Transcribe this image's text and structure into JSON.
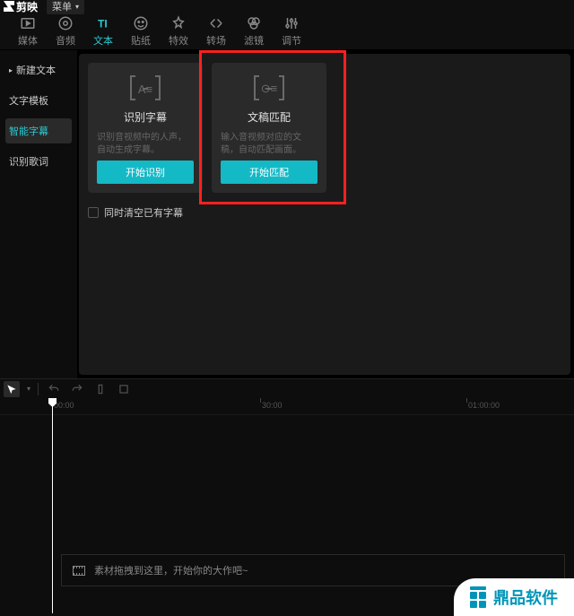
{
  "titlebar": {
    "app_name": "剪映",
    "menu_label": "菜单"
  },
  "toolbar": [
    {
      "id": "media",
      "label": "媒体"
    },
    {
      "id": "audio",
      "label": "音频"
    },
    {
      "id": "text",
      "label": "文本",
      "active": true
    },
    {
      "id": "sticker",
      "label": "贴纸"
    },
    {
      "id": "effect",
      "label": "特效"
    },
    {
      "id": "transition",
      "label": "转场"
    },
    {
      "id": "filter",
      "label": "滤镜"
    },
    {
      "id": "adjust",
      "label": "调节"
    }
  ],
  "sidebar": [
    {
      "id": "new-text",
      "label": "新建文本",
      "has_arrow": true
    },
    {
      "id": "text-template",
      "label": "文字模板"
    },
    {
      "id": "smart-subtitle",
      "label": "智能字幕",
      "active": true
    },
    {
      "id": "lyrics",
      "label": "识别歌词"
    }
  ],
  "cards": [
    {
      "id": "recognize",
      "icon_glyph": "A≡",
      "title": "识别字幕",
      "desc": "识别音视频中的人声，自动生成字幕。",
      "button": "开始识别"
    },
    {
      "id": "match",
      "icon_glyph": "⊙≡",
      "title": "文稿匹配",
      "desc": "输入音视频对应的文稿，自动匹配画面。",
      "button": "开始匹配",
      "highlighted": true
    }
  ],
  "checkbox": {
    "label": "同时清空已有字幕"
  },
  "ruler": {
    "ticks": [
      {
        "pos": 58,
        "label": "00:00"
      },
      {
        "pos": 290,
        "label": "30:00"
      },
      {
        "pos": 520,
        "label": "01:00:00"
      }
    ]
  },
  "timeline": {
    "drop_hint": "素材拖拽到这里，开始你的大作吧~"
  },
  "watermark": {
    "text": "鼎品软件"
  }
}
